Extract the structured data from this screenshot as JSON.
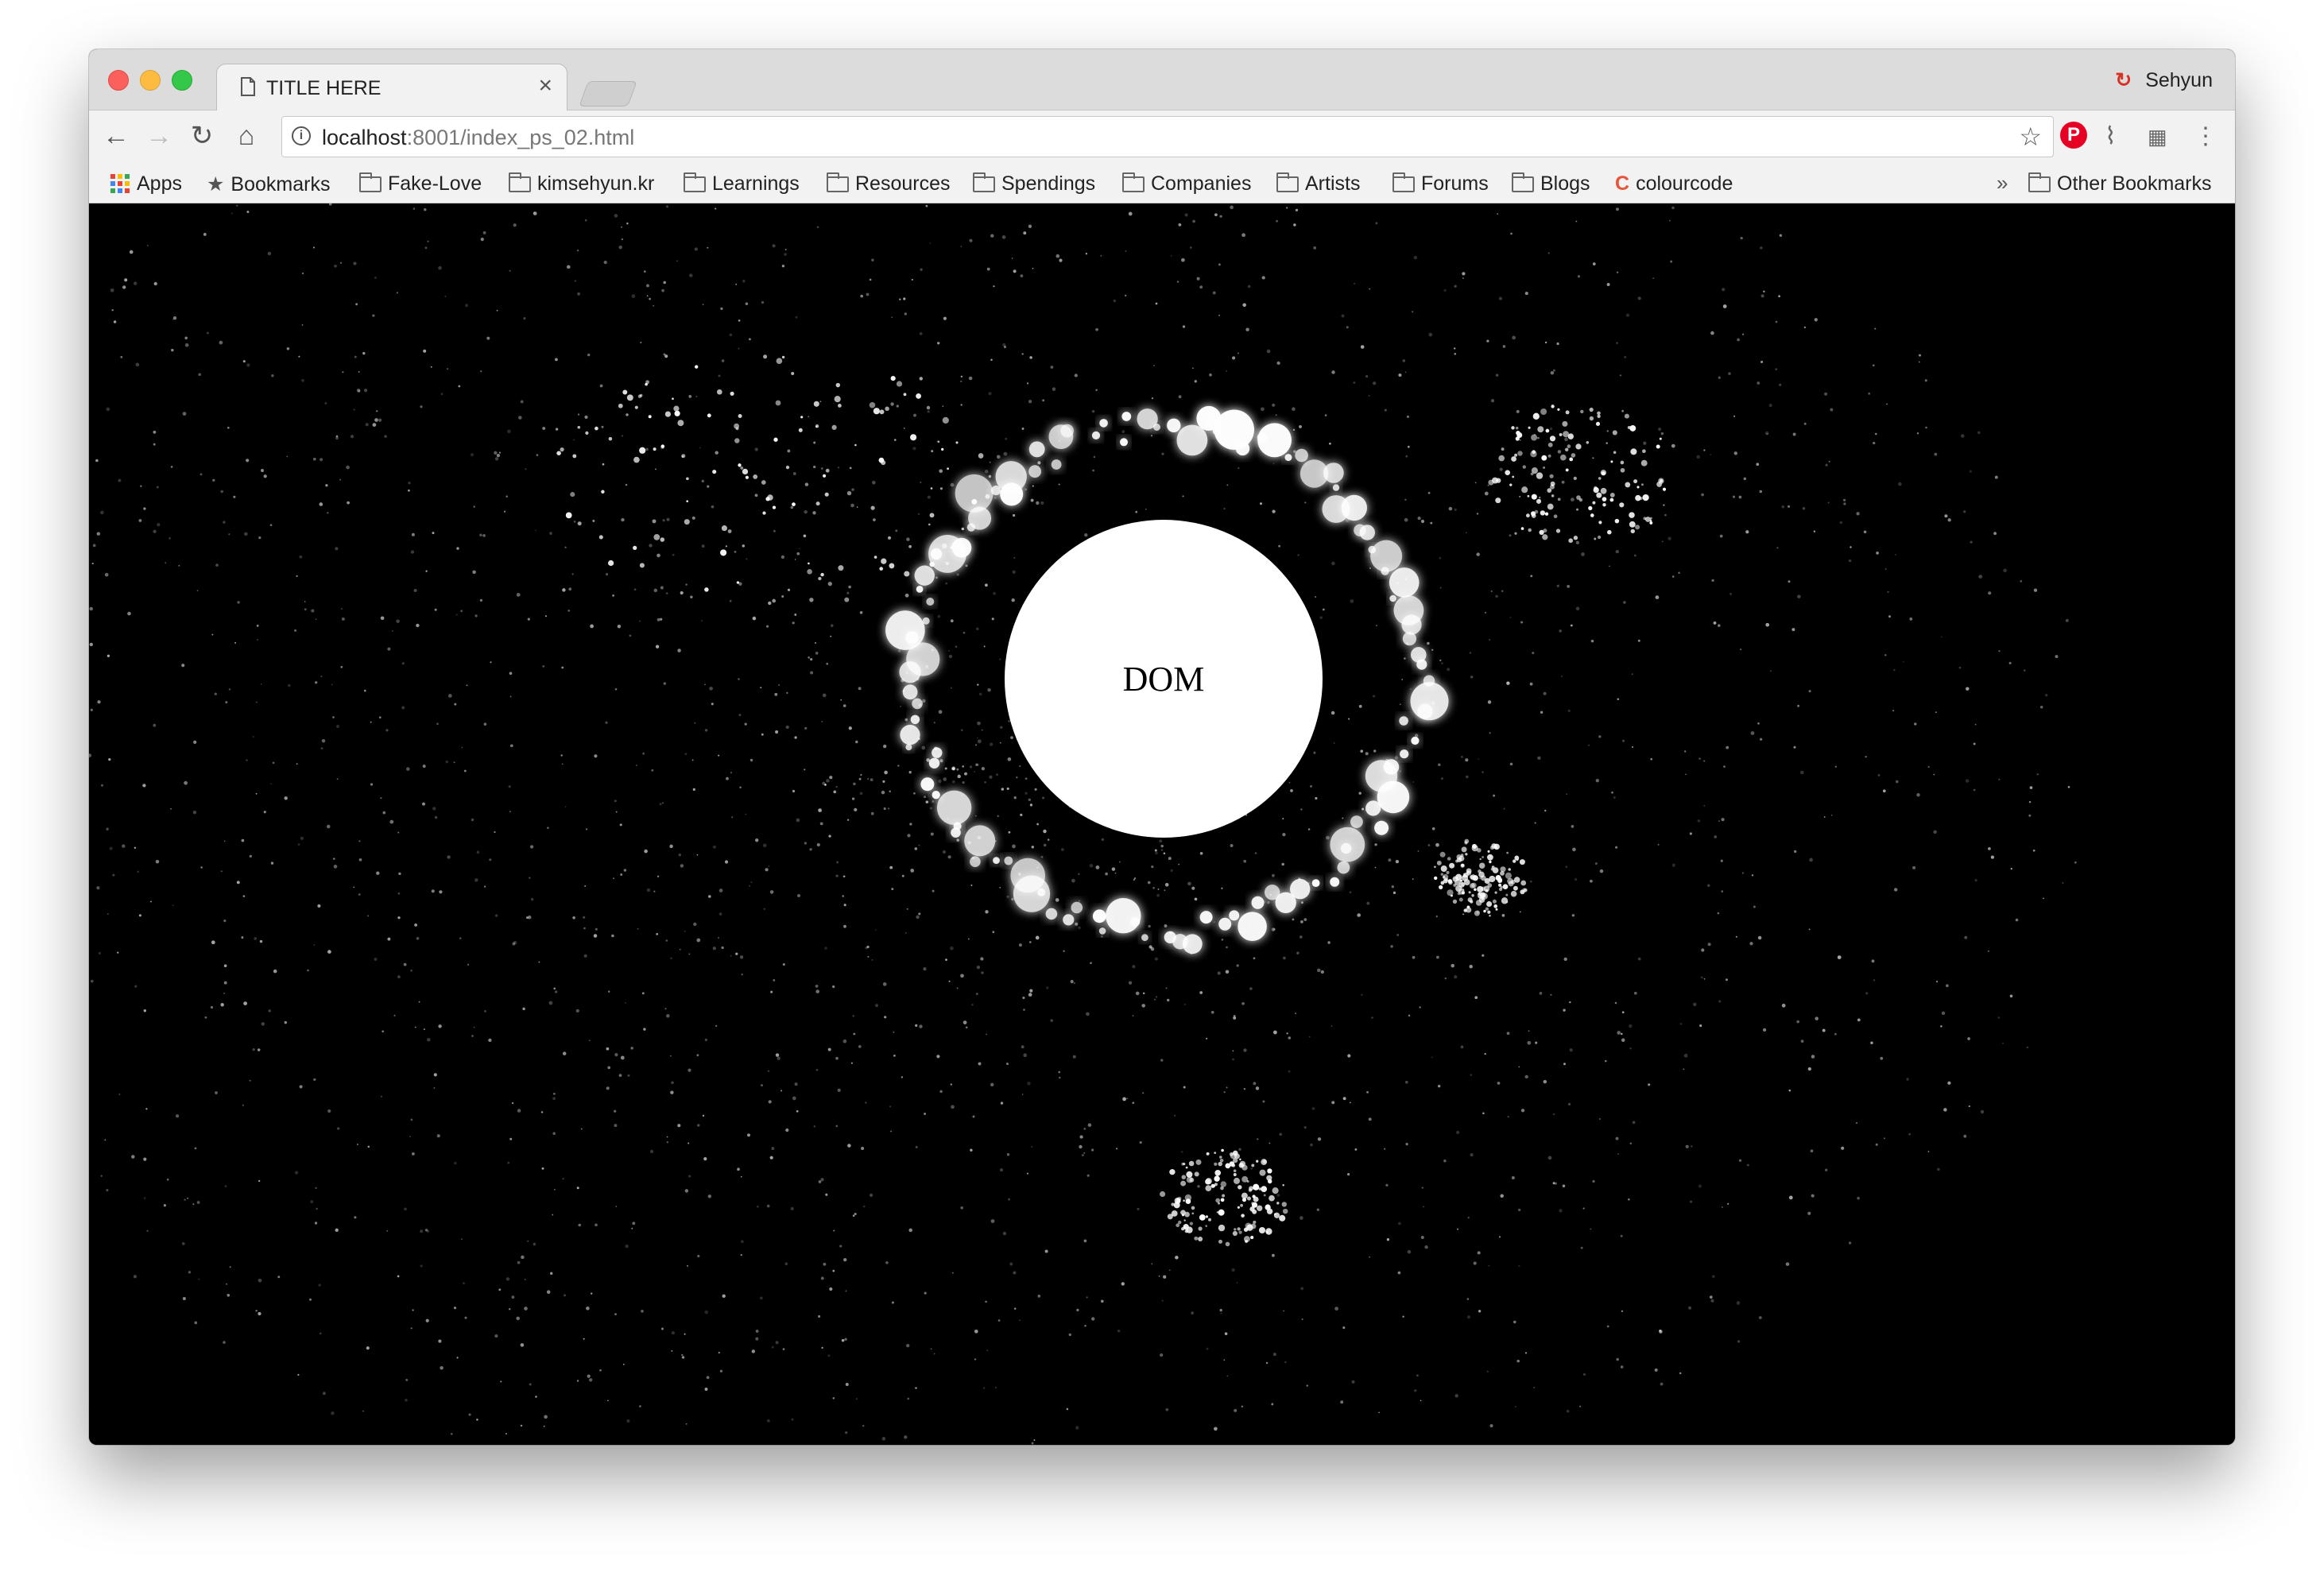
{
  "window": {
    "tab_title": "TITLE HERE",
    "tab_close": "×",
    "profile_name": "Sehyun"
  },
  "toolbar": {
    "url_host": "localhost",
    "url_rest": ":8001/index_ps_02.html"
  },
  "bookmarks": [
    {
      "label": "Apps",
      "icon": "apps-grid-icon"
    },
    {
      "label": "Bookmarks",
      "icon": "star-icon"
    },
    {
      "label": "Fake-Love",
      "icon": "folder-icon"
    },
    {
      "label": "kimsehyun.kr",
      "icon": "folder-icon"
    },
    {
      "label": "Learnings",
      "icon": "folder-icon"
    },
    {
      "label": "Resources",
      "icon": "folder-icon"
    },
    {
      "label": "Spendings",
      "icon": "folder-icon"
    },
    {
      "label": "Companies",
      "icon": "folder-icon"
    },
    {
      "label": "Artists",
      "icon": "folder-icon"
    },
    {
      "label": "Forums",
      "icon": "folder-icon"
    },
    {
      "label": "Blogs",
      "icon": "folder-icon"
    },
    {
      "label": "colourcode",
      "icon": "colourcode-icon"
    }
  ],
  "bookmarks_overflow": "»",
  "other_bookmarks": "Other Bookmarks",
  "content": {
    "center_label": "DOM",
    "background": "#000000",
    "particle_color": "#ffffff"
  },
  "colors": {
    "close": "#fc605c",
    "minimize": "#fdbc40",
    "maximize": "#34c84a",
    "pinterest": "#e60023"
  }
}
